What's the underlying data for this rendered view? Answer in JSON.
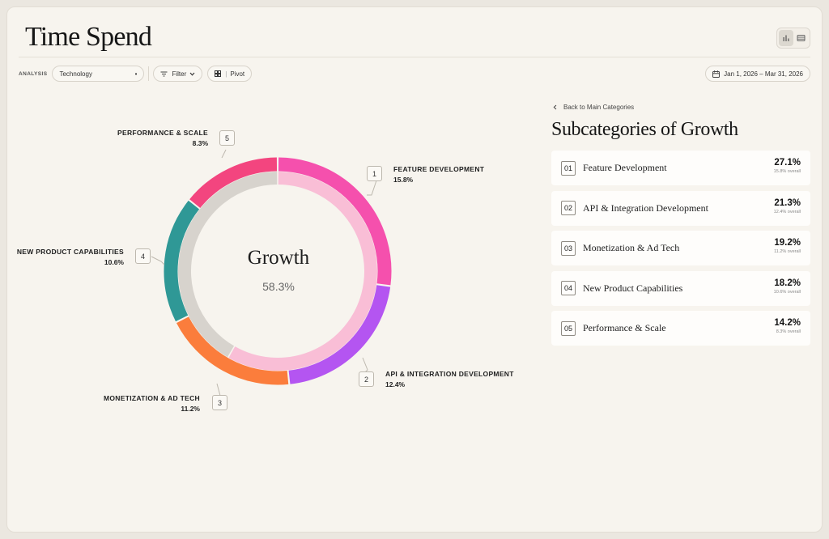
{
  "header": {
    "title": "Time Spend"
  },
  "toolbar": {
    "analysis_label": "ANALYSIS",
    "analysis_value": "Technology",
    "filter_label": "Filter",
    "pivot_label": "Pivot",
    "date_range": "Jan 1, 2026 – Mar 31, 2026"
  },
  "view_toggle": {
    "active": "chart"
  },
  "donut": {
    "center_title": "Growth",
    "center_pct": "58.3%",
    "colors": {
      "inner_fill": "#f9bed6",
      "inner_rest": "#d7d3cd"
    }
  },
  "callouts": [
    {
      "num": "1",
      "name": "FEATURE DEVELOPMENT",
      "pct": "15.8%"
    },
    {
      "num": "2",
      "name": "API & INTEGRATION DEVELOPMENT",
      "pct": "12.4%"
    },
    {
      "num": "3",
      "name": "MONETIZATION & AD TECH",
      "pct": "11.2%"
    },
    {
      "num": "4",
      "name": "NEW PRODUCT CAPABILITIES",
      "pct": "10.6%"
    },
    {
      "num": "5",
      "name": "PERFORMANCE & SCALE",
      "pct": "8.3%"
    }
  ],
  "segments": [
    {
      "value": 15.8,
      "color": "#f550ad"
    },
    {
      "value": 12.4,
      "color": "#b455f1"
    },
    {
      "value": 11.2,
      "color": "#fb7d3c"
    },
    {
      "value": 10.6,
      "color": "#2f9896"
    },
    {
      "value": 8.3,
      "color": "#f3457f"
    }
  ],
  "sidebar": {
    "back_label": "Back to Main Categories",
    "heading": "Subcategories of Growth",
    "items": [
      {
        "num": "01",
        "label": "Feature Development",
        "pct": "27.1%",
        "overall": "15.8% overall"
      },
      {
        "num": "02",
        "label": "API & Integration Development",
        "pct": "21.3%",
        "overall": "12.4% overall"
      },
      {
        "num": "03",
        "label": "Monetization & Ad Tech",
        "pct": "19.2%",
        "overall": "11.2% overall"
      },
      {
        "num": "04",
        "label": "New Product Capabilities",
        "pct": "18.2%",
        "overall": "10.6% overall"
      },
      {
        "num": "05",
        "label": "Performance & Scale",
        "pct": "14.2%",
        "overall": "8.3% overall"
      }
    ]
  }
}
